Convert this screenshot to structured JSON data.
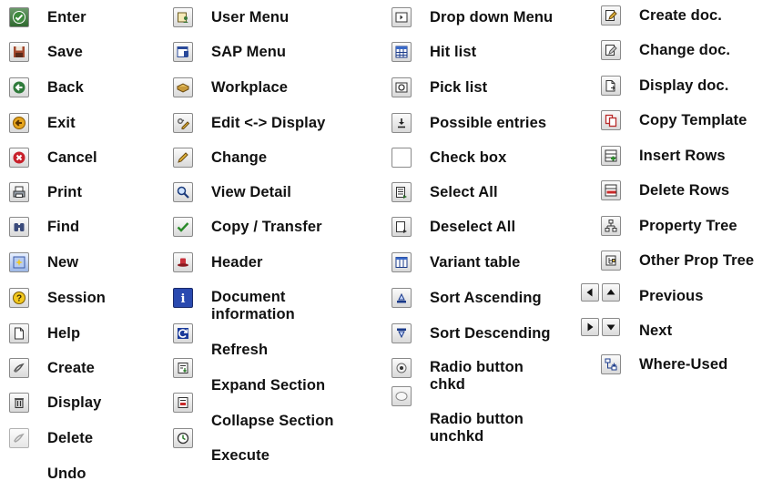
{
  "columns": [
    [
      {
        "label": "Enter",
        "icon": "check-circle-icon"
      },
      {
        "label": "Save",
        "icon": "floppy-disk-icon"
      },
      {
        "label": "Back",
        "icon": "back-arrow-icon"
      },
      {
        "label": "Exit",
        "icon": "exit-icon"
      },
      {
        "label": "Cancel",
        "icon": "cancel-icon"
      },
      {
        "label": "Print",
        "icon": "printer-icon"
      },
      {
        "label": "Find",
        "icon": "binoculars-icon"
      },
      {
        "label": "New",
        "icon": "new-sparkle-icon"
      },
      {
        "label": "Session",
        "icon": "session-icon"
      },
      {
        "label": "Help",
        "icon": "blank-page-icon"
      },
      {
        "label": "Create",
        "icon": "create-icon"
      },
      {
        "label": "Display",
        "icon": "trash-icon"
      },
      {
        "label": "Delete",
        "icon": "delete-icon"
      },
      {
        "label": "Undo",
        "icon": ""
      }
    ],
    [
      {
        "label": "User Menu",
        "icon": "user-menu-icon"
      },
      {
        "label": "SAP Menu",
        "icon": "sap-menu-icon"
      },
      {
        "label": "Workplace",
        "icon": "workplace-icon"
      },
      {
        "label": "Edit <-> Display",
        "icon": "glasses-pencil-icon"
      },
      {
        "label": "Change",
        "icon": "pencil-icon"
      },
      {
        "label": "View Detail",
        "icon": "magnifier-icon"
      },
      {
        "label": "Copy / Transfer",
        "icon": "green-check-icon"
      },
      {
        "label": "Header",
        "icon": "hat-icon"
      },
      {
        "label": "Document information",
        "icon": "info-icon"
      },
      {
        "label": "Refresh",
        "icon": "refresh-icon"
      },
      {
        "label": "Expand Section",
        "icon": "expand-section-icon"
      },
      {
        "label": "Collapse Section",
        "icon": "collapse-section-icon"
      },
      {
        "label": "Execute",
        "icon": "clock-icon"
      }
    ],
    [
      {
        "label": "Drop down Menu",
        "icon": "dropdown-menu-icon"
      },
      {
        "label": "Hit list",
        "icon": "hit-list-icon"
      },
      {
        "label": "Pick list",
        "icon": "pick-list-icon"
      },
      {
        "label": "Possible entries",
        "icon": "possible-entries-icon"
      },
      {
        "label": "Check box",
        "icon": "checkbox-icon"
      },
      {
        "label": "Select All",
        "icon": "select-all-icon"
      },
      {
        "label": "Deselect All",
        "icon": "deselect-all-icon"
      },
      {
        "label": "Variant table",
        "icon": "variant-table-icon"
      },
      {
        "label": "Sort Ascending",
        "icon": "sort-ascending-icon"
      },
      {
        "label": "Sort Descending",
        "icon": "sort-descending-icon"
      },
      {
        "label": "Radio button chkd",
        "icon": "radio-checked-icon"
      },
      {
        "label": "Radio button unchkd",
        "icon": "radio-unchecked-icon"
      }
    ],
    [
      {
        "label": "Create doc.",
        "icon": "create-doc-icon"
      },
      {
        "label": "Change doc.",
        "icon": "change-doc-icon"
      },
      {
        "label": "Display doc.",
        "icon": "display-doc-icon"
      },
      {
        "label": "Copy Template",
        "icon": "copy-template-icon"
      },
      {
        "label": "Insert Rows",
        "icon": "insert-rows-icon"
      },
      {
        "label": "Delete Rows",
        "icon": "delete-rows-icon"
      },
      {
        "label": "Property Tree",
        "icon": "property-tree-icon"
      },
      {
        "label": "Other Prop Tree",
        "icon": "other-prop-tree-icon"
      },
      {
        "label": "Previous",
        "icon": "previous-icons"
      },
      {
        "label": "Next",
        "icon": "next-icons"
      },
      {
        "label": "Where-Used",
        "icon": "where-used-icon"
      }
    ]
  ]
}
